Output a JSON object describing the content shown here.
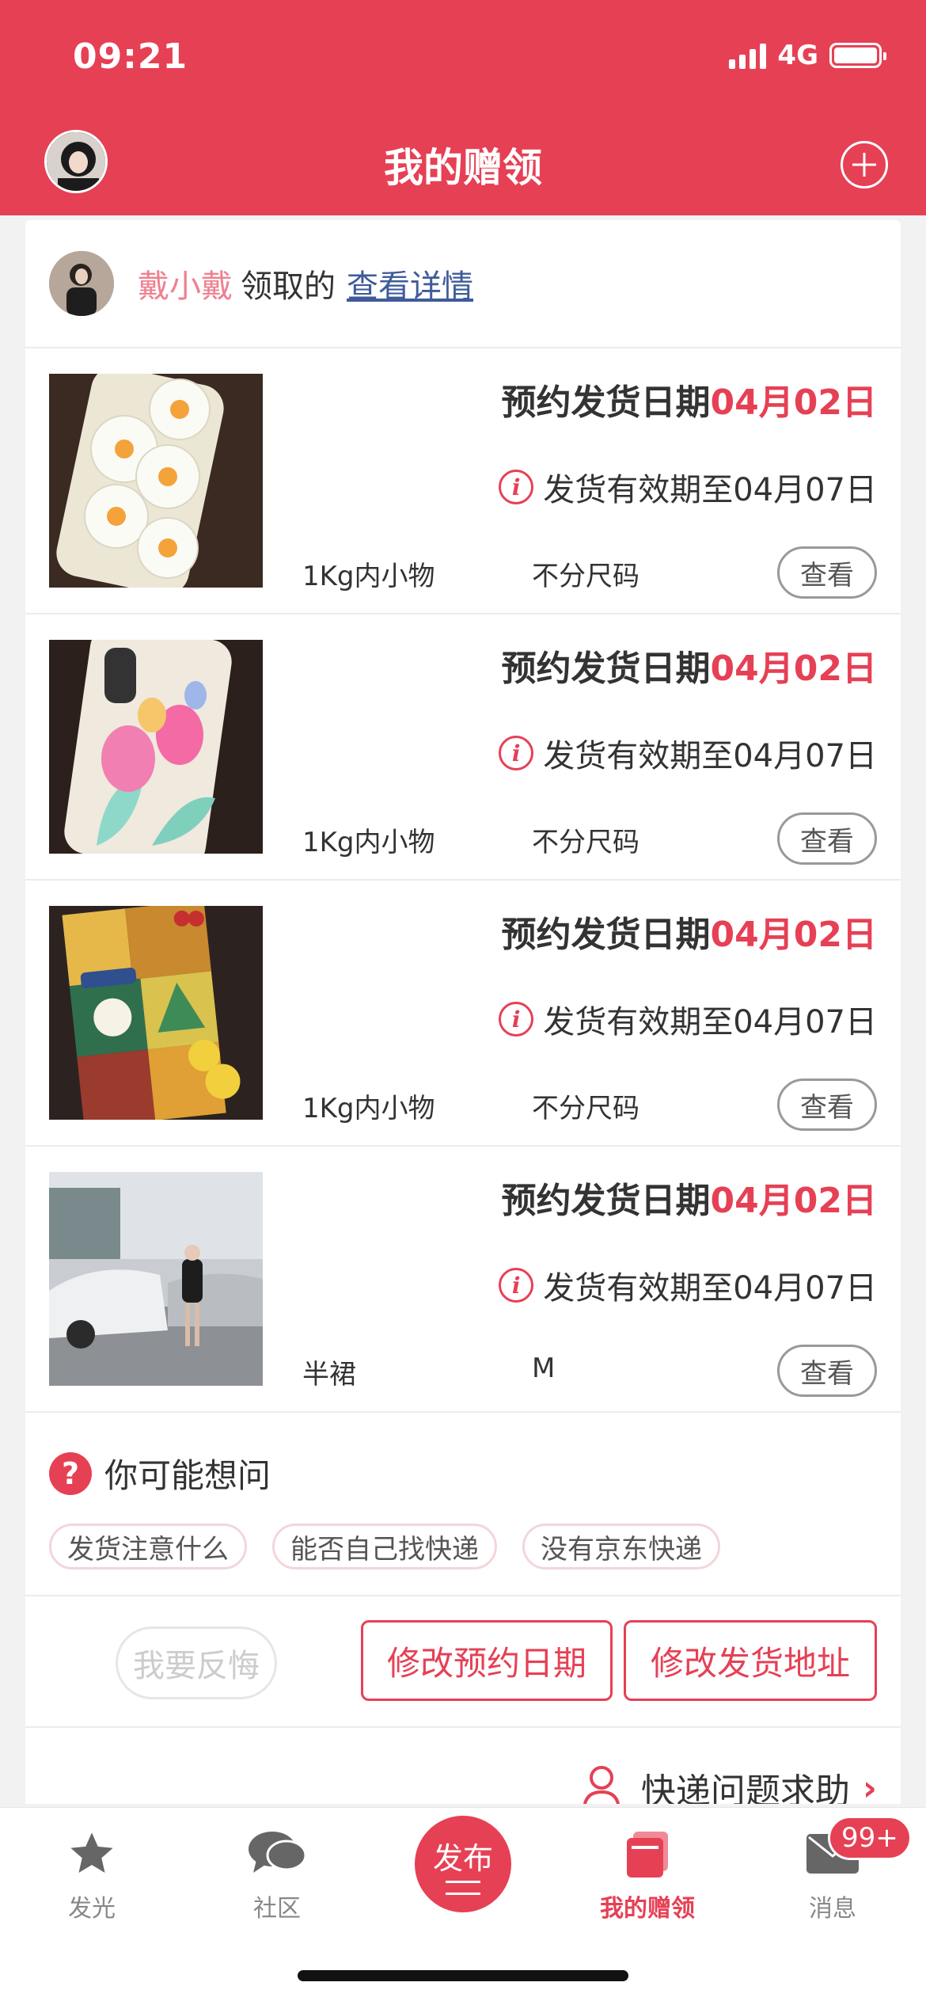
{
  "status_bar": {
    "time": "09:21",
    "network": "4G"
  },
  "header": {
    "title": "我的赠领"
  },
  "giver": {
    "name": "戴小戴",
    "action": "领取的",
    "link": "查看详情"
  },
  "items": [
    {
      "ship_label": "预约发货日期",
      "ship_date": "04月02日",
      "validity": "发货有效期至04月07日",
      "spec_a": "1Kg内小物",
      "spec_b": "不分尺码",
      "view": "查看",
      "thumb": "daisy-phone-case"
    },
    {
      "ship_label": "预约发货日期",
      "ship_date": "04月02日",
      "validity": "发货有效期至04月07日",
      "spec_a": "1Kg内小物",
      "spec_b": "不分尺码",
      "view": "查看",
      "thumb": "tulip-phone-case"
    },
    {
      "ship_label": "预约发货日期",
      "ship_date": "04月02日",
      "validity": "发货有效期至04月07日",
      "spec_a": "1Kg内小物",
      "spec_b": "不分尺码",
      "view": "查看",
      "thumb": "patchwork-phone-case"
    },
    {
      "ship_label": "预约发货日期",
      "ship_date": "04月02日",
      "validity": "发货有效期至04月07日",
      "spec_a": "半裙",
      "spec_b": "M",
      "view": "查看",
      "thumb": "street-photo"
    }
  ],
  "faq": {
    "title": "你可能想问",
    "chips": [
      "发货注意什么",
      "能否自己找快递",
      "没有京东快递"
    ]
  },
  "actions": {
    "regret": "我要反悔",
    "change_date": "修改预约日期",
    "change_address": "修改发货地址"
  },
  "help": {
    "label": "快递问题求助"
  },
  "tabbar": {
    "tab1": "发光",
    "tab2": "社区",
    "publish": "发布",
    "tab4": "我的赠领",
    "tab5": "消息",
    "badge": "99+"
  },
  "colors": {
    "primary": "#e64055",
    "name_pink": "#ef8090",
    "link_blue": "#3f5b9a"
  }
}
